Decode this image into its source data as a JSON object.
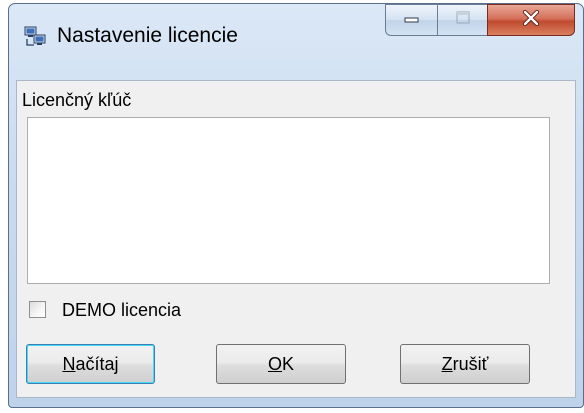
{
  "window": {
    "title": "Nastavenie licencie",
    "icon": "network-computers-icon"
  },
  "caption_buttons": {
    "minimize_icon": "minimize-icon",
    "maximize_icon": "maximize-icon",
    "close_icon": "close-icon"
  },
  "form": {
    "key_label": "Licenčný kľúč",
    "key_value": "",
    "demo_label": "DEMO licencia",
    "demo_checked": false
  },
  "buttons": {
    "load": {
      "mnemonic": "N",
      "rest": "ačítaj"
    },
    "ok": {
      "mnemonic": "O",
      "rest": "K"
    },
    "cancel": {
      "mnemonic": "Z",
      "rest": "rušiť"
    }
  },
  "colors": {
    "close_button": "#c04a2f",
    "default_button_focus": "#48d8fb",
    "frame": "#bed3ea"
  }
}
